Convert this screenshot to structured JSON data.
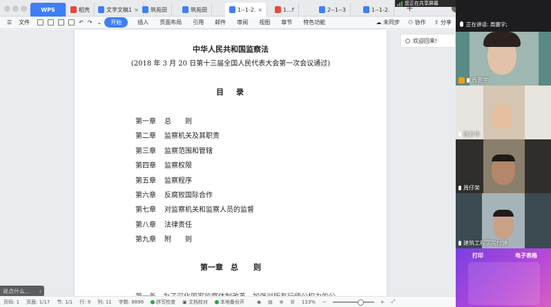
{
  "tabs": [
    {
      "label": "WPS",
      "type": "wps"
    },
    {
      "label": "稻壳",
      "icon": "docer-icon"
    },
    {
      "label": "文字文稿1",
      "icon": "doc-icon"
    },
    {
      "label": "筑苑田",
      "icon": "doc-icon"
    },
    {
      "label": "筑苑田",
      "icon": "doc-icon"
    },
    {
      "label": "1--1-2.",
      "icon": "doc-icon",
      "active": true
    },
    {
      "label": "1...f",
      "icon": "pdf-icon"
    },
    {
      "label": "2--1--3",
      "icon": "doc-icon"
    },
    {
      "label": "1--1-2.",
      "icon": "doc-icon"
    }
  ],
  "share_banner": "您正在共享屏幕",
  "menu": {
    "file": "文件",
    "items": [
      "开始",
      "插入",
      "页面布局",
      "引用",
      "邮件",
      "审阅",
      "视图",
      "章节",
      "特色功能"
    ],
    "sync": "未同步",
    "collab": "协作",
    "share": "分享"
  },
  "side_panel": {
    "welcome": "欢迎回来!"
  },
  "document": {
    "title": "中华人民共和国监察法",
    "subtitle": "(2018 年 3 月 20 日第十三届全国人民代表大会第一次会议通过)",
    "toc_head_1": "目",
    "toc_head_2": "录",
    "toc": [
      {
        "ch": "第一章",
        "t": "总　　则"
      },
      {
        "ch": "第二章",
        "t": "监察机关及其职责"
      },
      {
        "ch": "第三章",
        "t": "监察范围和管辖"
      },
      {
        "ch": "第四章",
        "t": "监察权限"
      },
      {
        "ch": "第五章",
        "t": "监察程序"
      },
      {
        "ch": "第六章",
        "t": "反腐败国际合作"
      },
      {
        "ch": "第七章",
        "t": "对监察机关和监察人员的监督"
      },
      {
        "ch": "第八章",
        "t": "法律责任"
      },
      {
        "ch": "第九章",
        "t": "附　　则"
      }
    ],
    "chapter_head": "第一章　总　　则",
    "body_partial": "第一条　为了深化国家监察体制改革，加强对所有行使公权力的公"
  },
  "say_box": "说点什么...",
  "status": {
    "page_code": "页码: 1",
    "pages": "页面: 1/17",
    "section": "节: 1/1",
    "row": "行: 9",
    "col": "列: 11",
    "words": "字数: 8896",
    "spell": "拼写检查",
    "proof": "文档校对",
    "backup": "本地备份开",
    "zoom": "133%"
  },
  "meeting": {
    "speaking": "正在讲话: 周惠宇;",
    "participants": [
      {
        "name": "周惠宇"
      },
      {
        "name": "张方华"
      },
      {
        "name": "周仔荣"
      },
      {
        "name": "建筑工程学院付健"
      }
    ]
  },
  "dock": {
    "print": "打印",
    "sheet": "电子表格"
  },
  "colors": {
    "accent": "#3f7ef6",
    "panel": "#1d1d1f"
  }
}
